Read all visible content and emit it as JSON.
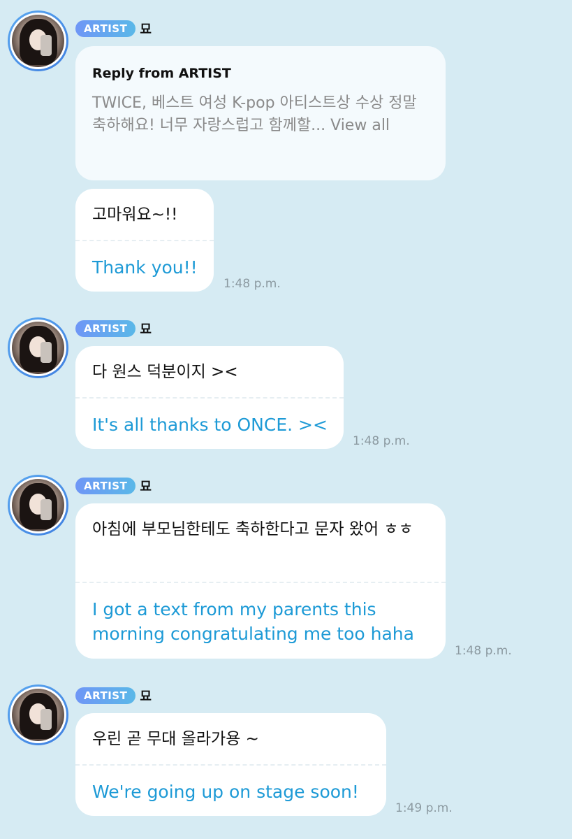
{
  "colors": {
    "background": "#d6ebf3",
    "bubble": "#ffffff",
    "translation_text": "#1d9ad6",
    "badge_start": "#6f96f6",
    "badge_end": "#5ab8e8"
  },
  "messages": [
    {
      "badge": "ARTIST",
      "sender": "묘",
      "reply_title": "Reply from ARTIST",
      "reply_text": "TWICE, 베스트 여성 K-pop 아티스트상 수상 정말 축하해요! 너무 자랑스럽고 함께할... View all",
      "korean": "고마워요~!!",
      "english": "Thank you!!",
      "time": "1:48 p.m."
    },
    {
      "badge": "ARTIST",
      "sender": "묘",
      "korean": "다 원스 덕분이지 ><",
      "english": "It's all thanks to ONCE. ><",
      "time": "1:48 p.m."
    },
    {
      "badge": "ARTIST",
      "sender": "묘",
      "korean": "아침에 부모님한테도 축하한다고 문자 왔어 ㅎㅎ",
      "english": "I got a text from my parents this morning congratulating me too haha",
      "time": "1:48 p.m."
    },
    {
      "badge": "ARTIST",
      "sender": "묘",
      "korean": "우린 곧 무대 올라가용 ~",
      "english": "We're going up on stage soon!",
      "time": "1:49 p.m."
    }
  ]
}
